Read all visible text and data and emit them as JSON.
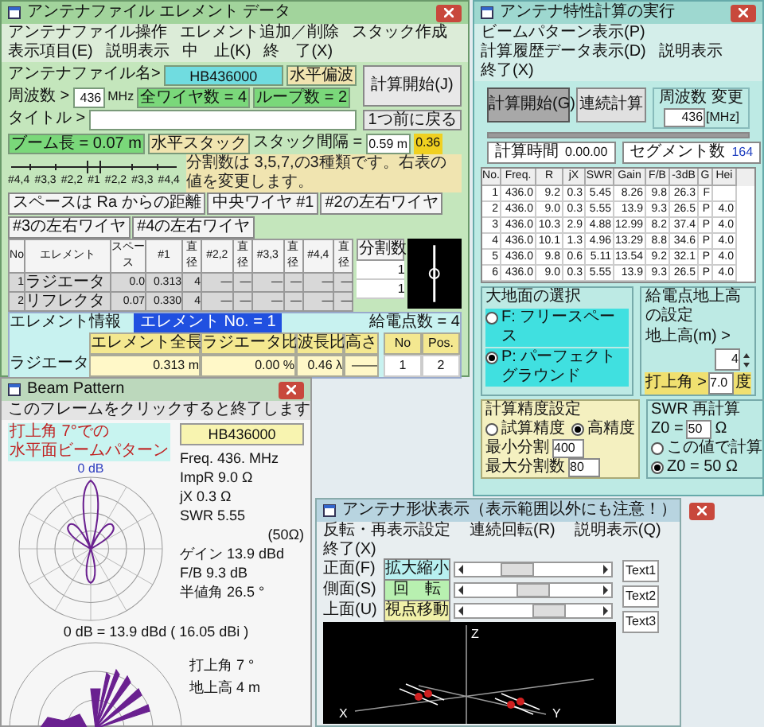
{
  "main_window": {
    "title": "アンテナファイル エレメント データ",
    "menu": [
      "アンテナファイル操作",
      "エレメント追加／削除",
      "スタック作成",
      "表示項目(E)",
      "説明表示",
      "中　止(K)",
      "終　了(X)"
    ],
    "file_label": "アンテナファイル名>",
    "file_name": "HB436000",
    "polarization": "水平偏波",
    "calc_button": "計算開始(J)",
    "back_button": "1つ前に戻る",
    "freq_label": "周波数 >",
    "freq_value": "436",
    "freq_unit": "MHz",
    "wire_count": "全ワイヤ数 = 4",
    "loop_count": "ループ数 = 2",
    "title_label": "タイトル >",
    "boom": "ブーム長 = 0.07 m",
    "stack_type": "水平スタック",
    "stack_spacing_label": "スタック間隔 =",
    "stack_spacing_value": "0.59 m",
    "stack_ratio": "0.36",
    "element_positions": [
      "#4,4",
      "#3,3",
      "#2,2",
      "#1",
      "#2,2",
      "#3,3",
      "#4,4"
    ],
    "note": "分割数は 3,5,7,の3種類です。右表の値を変更します。",
    "column_groups": [
      "スペースは Ra からの距離",
      "中央ワイヤ #1",
      "#2の左右ワイヤ",
      "#3の左右ワイヤ",
      "#4の左右ワイヤ"
    ],
    "table": {
      "columns": [
        "No",
        "エレメント",
        "スペース",
        "#1",
        "直径",
        "#2,2",
        "直径",
        "#3,3",
        "直径",
        "#4,4",
        "直径"
      ],
      "rows": [
        [
          "1",
          "ラジエータ",
          "0.0",
          "0.313",
          "4",
          "—",
          "—",
          "—",
          "—",
          "—",
          "—"
        ],
        [
          "2",
          "リフレクタ",
          "0.07",
          "0.330",
          "4",
          "—",
          "—",
          "—",
          "—",
          "—",
          "—"
        ]
      ]
    },
    "divisions": {
      "header": "分割数",
      "values": [
        "1",
        "1"
      ]
    },
    "element_info": {
      "title": "エレメント情報",
      "selected_label": "エレメント No. = 1",
      "name": "ラジエータ",
      "columns": [
        "エレメント全長",
        "ラジエータ比",
        "波長比",
        "高さ"
      ],
      "values": [
        "0.313 m",
        "0.00 %",
        "0.46 λ",
        "——"
      ]
    },
    "feed": {
      "label": "給電点数 = 4",
      "columns": [
        "No",
        "Pos."
      ],
      "rows": [
        [
          "1",
          "2"
        ]
      ]
    }
  },
  "calc_window": {
    "title": "アンテナ特性計算の実行",
    "menu": [
      "ビームパターン表示(P)",
      "計算履歴データ表示(D)",
      "説明表示",
      "終了(X)"
    ],
    "start_button": "計算開始(G)",
    "continuous_button": "連続計算",
    "freq_group": "周波数 変更",
    "freq_value": "436",
    "freq_unit": "[MHz]",
    "progress": {
      "level": 1
    },
    "time_label": "計算時間",
    "time_value": "0.00.00",
    "segment_label": "セグメント数",
    "segment_value": "164",
    "table": {
      "columns": [
        "No.",
        "Freq.",
        "R",
        "jX",
        "SWR",
        "Gain",
        "F/B",
        "-3dB",
        "G",
        "Hei"
      ],
      "rows": [
        [
          "1",
          "436.0",
          "9.2",
          "0.3",
          "5.45",
          "8.26",
          "9.8",
          "26.3",
          "F",
          ""
        ],
        [
          "2",
          "436.0",
          "9.0",
          "0.3",
          "5.55",
          "13.9",
          "9.3",
          "26.5",
          "P",
          "4.0"
        ],
        [
          "3",
          "436.0",
          "10.3",
          "2.9",
          "4.88",
          "12.99",
          "8.2",
          "37.4",
          "P",
          "4.0"
        ],
        [
          "4",
          "436.0",
          "10.1",
          "1.3",
          "4.96",
          "13.29",
          "8.8",
          "34.6",
          "P",
          "4.0"
        ],
        [
          "5",
          "436.0",
          "9.8",
          "0.6",
          "5.11",
          "13.54",
          "9.2",
          "32.1",
          "P",
          "4.0"
        ],
        [
          "6",
          "436.0",
          "9.0",
          "0.3",
          "5.55",
          "13.9",
          "9.3",
          "26.5",
          "P",
          "4.0"
        ]
      ]
    },
    "ground": {
      "title": "大地面の選択",
      "options": [
        {
          "label": "F: フリースペース",
          "selected": false
        },
        {
          "label": "P: パーフェクトグラウンド",
          "selected": true
        }
      ]
    },
    "height": {
      "title": "給電点地上高の設定",
      "height_label": "地上高(m) >",
      "height_value": "4",
      "angle_label": "打上角 >",
      "angle_value": "7.0",
      "angle_unit": "度"
    },
    "precision": {
      "title": "計算精度設定",
      "options": [
        {
          "label": "試算精度",
          "selected": false
        },
        {
          "label": "高精度",
          "selected": true
        }
      ],
      "min_label": "最小分割",
      "min_value": "400",
      "max_label": "最大分割数",
      "max_value": "80"
    },
    "swr": {
      "title": "SWR 再計算",
      "z0_label": "Z0 =",
      "z0_value": "50",
      "z0_unit": "Ω",
      "options": [
        {
          "label": "この値で計算",
          "selected": false
        },
        {
          "label": "Z0 = 50 Ω",
          "selected": true
        }
      ]
    }
  },
  "beam_window": {
    "title": "Beam Pattern",
    "hint": "このフレームをクリックすると終了します",
    "legend": [
      "打上角 7°での",
      "水平面ビームパターン"
    ],
    "zero_db": "0 dB",
    "file_name": "HB436000",
    "readings": [
      "Freq. 436. MHz",
      "ImpR 9.0 Ω",
      "jX 0.3 Ω",
      "SWR 5.55",
      "(50Ω)",
      "ゲイン 13.9 dBd",
      "F/B 9.3 dB",
      "半値角 26.5 °"
    ],
    "reference": "0 dB = 13.9 dBd ( 16.05 dBi )",
    "elevation": [
      "打上角 7 °",
      "地上高 4 m"
    ]
  },
  "shape_window": {
    "title": "アンテナ形状表示（表示範囲以外にも注意！）",
    "menu": [
      "反転・再表示設定",
      "連続回転(R)",
      "説明表示(Q)",
      "終了(X)"
    ],
    "views": [
      {
        "label": "正面(F)",
        "action": "拡大縮小",
        "color": "#b8f0f0"
      },
      {
        "label": "側面(S)",
        "action": "回　転",
        "color": "#b8f0b0"
      },
      {
        "label": "上面(U)",
        "action": "視点移動",
        "color": "#f0f0a8"
      }
    ],
    "text_boxes": [
      "Text1",
      "Text2",
      "Text3"
    ],
    "axes": [
      "Z",
      "X",
      "Y"
    ]
  }
}
